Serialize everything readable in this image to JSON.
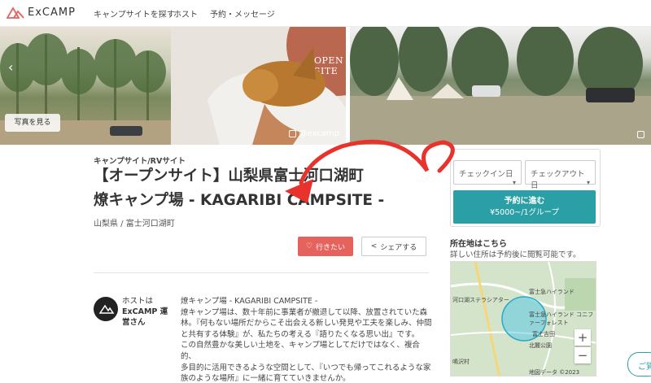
{
  "header": {
    "logo_text": "ExCAMP",
    "nav": [
      "キャンプサイトを探す",
      "ホスト",
      "予約・メッセージ"
    ],
    "brand_color": "#e5625d"
  },
  "photos": {
    "open_site_text": "OPEN SITE",
    "instagram_handle": "@excamp",
    "view_photos_label": "写真を見る"
  },
  "listing": {
    "category": "キャンプサイト/RVサイト",
    "title_line1": "【オープンサイト】山梨県富士河口湖町",
    "title_line2": "燎キャンプ場 - KAGARIBI CAMPSITE -",
    "location": "山梨県 / 富士河口湖町",
    "want_label": "行きたい",
    "share_label": "シェアする"
  },
  "host": {
    "prefix": "ホストは",
    "name": "ExCAMP 運営さん",
    "desc_lines": [
      "燎キャンプ場 - KAGARIBI CAMPSITE -",
      "燎キャンプ場は、数十年前に事業者が撤退して以降、放置されていた森",
      "林。『何もない場所だからこそ出会える新しい発見や工夫を楽しみ、仲間",
      "と共有する体験』が、私たちの考える『語りたくなる思い出』です。",
      "この自然豊かな美しい土地を、キャンプ場としてだけではなく、複合的、",
      "多目的に活用できるような空間として、『いつでも帰ってこれるような家",
      "族のような場所』に一緒に育てていきませんか。"
    ]
  },
  "booking": {
    "checkin_placeholder": "チェックイン日",
    "checkout_placeholder": "チェックアウト日",
    "reserve_label": "予約に進む",
    "price_label": "¥5000~/1グループ",
    "accent_color": "#2aa0a6"
  },
  "location_box": {
    "title": "所在地はこちら",
    "note": "詳しい住所は予約後に閲覧可能です。",
    "map_labels": [
      "富士急ハイランド",
      "河口湖ステラシアター",
      "富士急ハイランド コニファーフォレスト",
      "北麓公園",
      "鳴沢村",
      "富士吉田",
      "地図データ ©2023"
    ],
    "zoom_in": "+",
    "zoom_out": "−"
  },
  "chat": {
    "label": "ご質"
  }
}
